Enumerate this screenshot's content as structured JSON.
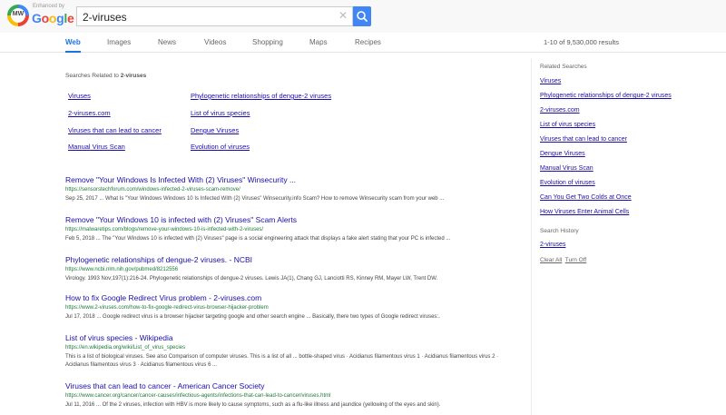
{
  "header": {
    "logo_text": "MW",
    "enhanced_by": "Enhanced by",
    "google_word": "Google",
    "search_value": "2-viruses"
  },
  "tabs": [
    "Web",
    "Images",
    "News",
    "Videos",
    "Shopping",
    "Maps",
    "Recipes"
  ],
  "result_count": "1-10 of 9,530,000 results",
  "related": {
    "title_prefix": "Searches Related to ",
    "title_query": "2-viruses",
    "left": [
      "Viruses",
      "2-viruses.com",
      "Viruses that can lead to cancer",
      "Manual Virus Scan"
    ],
    "right": [
      "Phylogenetic relationships of dengue-2 viruses",
      "List of virus species",
      "Dengue Viruses",
      "Evolution of viruses"
    ]
  },
  "results": [
    {
      "title": "Remove \"Your Windows Is Infected With (2) Viruses\" Winsecurity ...",
      "url": "https://sensorstechforum.com/windows-infected-2-viruses-scam-remove/",
      "snippet": "Sep 25, 2017 ... What Is \"Your Windows Windows 10 Is Infected With (2) Viruses\" Winsecurity.info Scam? How to remove Winsecurity scam from your web ..."
    },
    {
      "title": "Remove \"Your Windows 10 is infected with (2) Viruses\" Scam Alerts",
      "url": "https://malwaretips.com/blogs/remove-your-windows-10-is-infected-with-2-viruses/",
      "snippet": "Feb 5, 2018 ... The \"Your Windows 10 is infected with (2) Viruses\" page is a social engineering attack that displays a fake alert stating that your PC is infected ..."
    },
    {
      "title": "Phylogenetic relationships of dengue-2 viruses. - NCBI",
      "url": "https://www.ncbi.nlm.nih.gov/pubmed/8212556",
      "snippet": "Virology. 1993 Nov;197(1):216-24. Phylogenetic relationships of dengue-2 viruses. Lewis JA(1), Chang GJ, Lanciotti RS, Kinney RM, Mayer LW, Trent DW."
    },
    {
      "title": "How to fix Google Redirect Virus problem - 2-viruses.com",
      "url": "https://www.2-viruses.com/how-to-fix-google-redirect-virus-browser-hijacker-problem",
      "snippet": "Jul 17, 2018 ... Google redirect virus is a browser hijacker targeting google and other search engine ... Basically, there two types of Google redirect viruses:."
    },
    {
      "title": "List of virus species - Wikipedia",
      "url": "https://en.wikipedia.org/wiki/List_of_virus_species",
      "snippet": "This is a list of biological viruses. See also Comparison of computer viruses. This is a list of all ... bottle-shaped virus · Acidianus filamentous virus 1 · Acidianus filamentous virus 2 · Acidianus filamentous virus 3 · Acidianus filamentous virus 6 ..."
    },
    {
      "title": "Viruses that can lead to cancer - American Cancer Society",
      "url": "https://www.cancer.org/cancer/cancer-causes/infectious-agents/infections-that-can-lead-to-cancer/viruses.html",
      "snippet": "Jul 11, 2016 ... Of the 2 viruses, infection with HBV is more likely to cause symptoms, such as a flu-like illness and jaundice (yellowing of the eyes and skin)."
    }
  ],
  "sidebar": {
    "related_heading": "Related Searches",
    "links": [
      "Viruses",
      "Phylogenetic relationships of dengue-2 viruses",
      "2-viruses.com",
      "List of virus species",
      "Viruses that can lead to cancer",
      "Dengue Viruses",
      "Manual Virus Scan",
      "Evolution of viruses",
      "Can You Get Two Colds at Once",
      "How Viruses Enter Animal Cells"
    ],
    "history_heading": "Search History",
    "history_links": [
      "2-viruses"
    ],
    "clear_all": "Clear All",
    "turn_off": "Turn Off"
  }
}
